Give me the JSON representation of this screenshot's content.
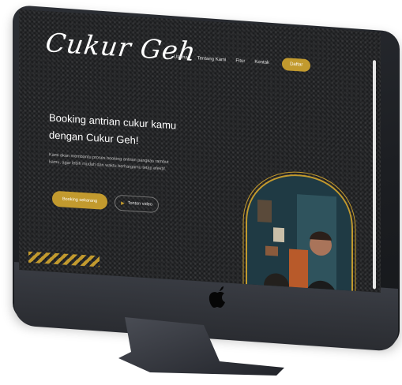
{
  "site": {
    "logo": "Cukur Geh",
    "nav": {
      "items": [
        "Utama",
        "Tentang Kami",
        "Fitur",
        "Kontak"
      ],
      "cta": "Daftar"
    },
    "hero": {
      "title_line1": "Booking antrian cukur kamu",
      "title_line2": "dengan Cukur Geh!",
      "description": "Kami akan membantu proses booking antrian pangkas rambut kamu, agar lebih mudah dan waktu berhargamu tetap efektif.",
      "primary_button": "Booking sekarang",
      "secondary_button": "Tonton video"
    }
  },
  "colors": {
    "accent": "#c29a2e",
    "background": "#1e1f21",
    "device": "#2a2c31"
  },
  "icons": [
    "apple-icon",
    "play-icon"
  ]
}
